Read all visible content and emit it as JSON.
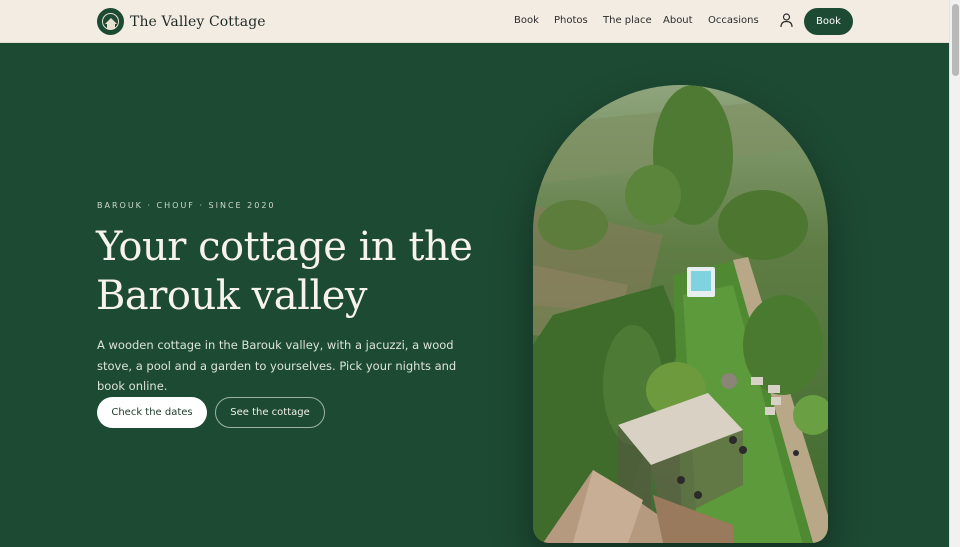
{
  "header": {
    "brand": "The Valley Cottage",
    "nav": [
      "Book",
      "Photos",
      "The place",
      "About",
      "Occasions"
    ],
    "book_label": "Book"
  },
  "hero": {
    "eyebrow": "BAROUK · CHOUF · SINCE 2020",
    "title_line1": "Your cottage in the",
    "title_line2": "Barouk valley",
    "lead": "A wooden cottage in the Barouk valley, with a jacuzzi, a wood stove, a pool and a garden to yourselves. Pick your nights and book online.",
    "primary_cta": "Check the dates",
    "secondary_cta": "See the cottage"
  },
  "icons": {
    "user": "user-icon",
    "logo": "cottage-logo-icon"
  },
  "colors": {
    "brand_green": "#1d4a33",
    "header_bg": "#f3ece3"
  }
}
